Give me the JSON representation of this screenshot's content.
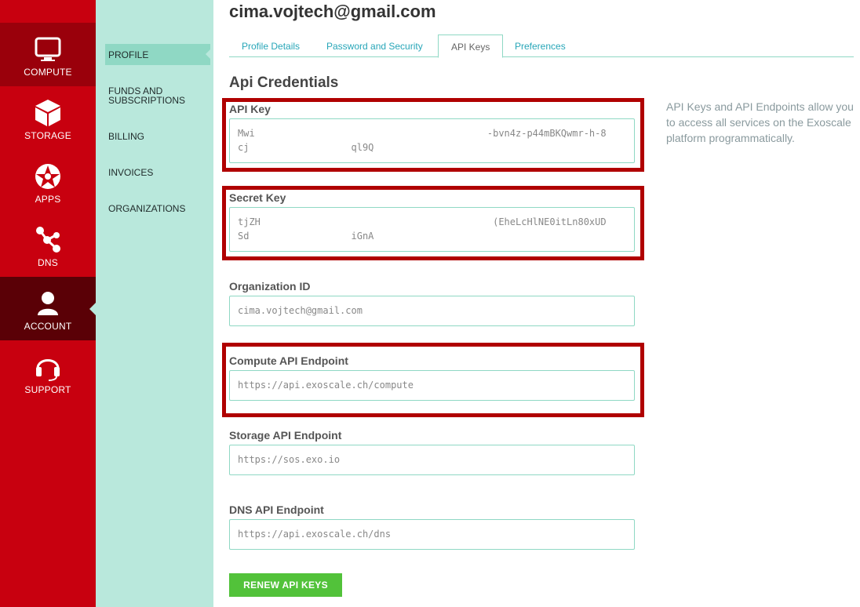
{
  "rail": {
    "items": [
      {
        "label": "COMPUTE",
        "icon": "monitor-icon"
      },
      {
        "label": "STORAGE",
        "icon": "box-icon"
      },
      {
        "label": "APPS",
        "icon": "star-icon"
      },
      {
        "label": "DNS",
        "icon": "network-icon"
      },
      {
        "label": "ACCOUNT",
        "icon": "user-icon"
      },
      {
        "label": "SUPPORT",
        "icon": "headset-icon"
      }
    ],
    "active": "ACCOUNT"
  },
  "subnav": {
    "items": [
      {
        "label": "PROFILE"
      },
      {
        "label": "FUNDS AND SUBSCRIPTIONS"
      },
      {
        "label": "BILLING"
      },
      {
        "label": "INVOICES"
      },
      {
        "label": "ORGANIZATIONS"
      }
    ],
    "active": "PROFILE"
  },
  "header": {
    "user_email": "cima.vojtech@gmail.com"
  },
  "tabs": [
    {
      "label": "Profile Details"
    },
    {
      "label": "Password and Security"
    },
    {
      "label": "API Keys"
    },
    {
      "label": "Preferences"
    }
  ],
  "active_tab": "API Keys",
  "main": {
    "section_title": "Api Credentials",
    "api_key": {
      "label": "API Key",
      "value": "Mwi                                         -bvn4z-p44mBKQwmr-h-8\ncj                  ql9Q"
    },
    "secret_key": {
      "label": "Secret Key",
      "value": "tjZH                                         (EheLcHlNE0itLn80xUD\nSd                  iGnA"
    },
    "organization_id": {
      "label": "Organization ID",
      "value": "cima.vojtech@gmail.com"
    },
    "compute_endpoint": {
      "label": "Compute API Endpoint",
      "value": "https://api.exoscale.ch/compute"
    },
    "storage_endpoint": {
      "label": "Storage API Endpoint",
      "value": "https://sos.exo.io"
    },
    "dns_endpoint": {
      "label": "DNS API Endpoint",
      "value": "https://api.exoscale.ch/dns"
    },
    "help_text": "API Keys and API Endpoints allow you to access all services on the Exoscale platform programmatically.",
    "renew_button": "RENEW API KEYS"
  },
  "colors": {
    "brand_red": "#c8000f",
    "mint": "#b9e8dc",
    "accent_teal": "#27a6b8",
    "button_green": "#52c23a",
    "highlight_red": "#b00000"
  }
}
